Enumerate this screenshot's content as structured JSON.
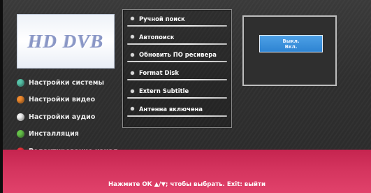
{
  "logo": {
    "text": "HD DVB"
  },
  "main_menu": {
    "items": [
      {
        "label": "Настройки системы",
        "color": "#58c4aa"
      },
      {
        "label": "Настройки видео",
        "color": "#f08a2e"
      },
      {
        "label": "Настройки аудио",
        "color": "#f2f2f2"
      },
      {
        "label": "Инсталляция",
        "color": "#66c24a"
      },
      {
        "label": "Редактирование канал",
        "color": "#e8343a"
      }
    ]
  },
  "submenu": {
    "items": [
      {
        "label": "Ручной поиск"
      },
      {
        "label": "Автопоиск"
      },
      {
        "label": "Обновить ПО ресивера"
      },
      {
        "label": "Format Disk"
      },
      {
        "label": "Extern Subtitle"
      },
      {
        "label": "Антенна включена"
      }
    ]
  },
  "options": {
    "items": [
      "Выкл.",
      "Вкл."
    ],
    "selected": "Вкл."
  },
  "footer": {
    "hint": "Нажмите ОК ▲/▼; чтобы выбрать. Exit: выйти"
  },
  "colors": {
    "bottom_bar": "#d4345e",
    "selection": "#3a90dc",
    "background": "#303030"
  }
}
